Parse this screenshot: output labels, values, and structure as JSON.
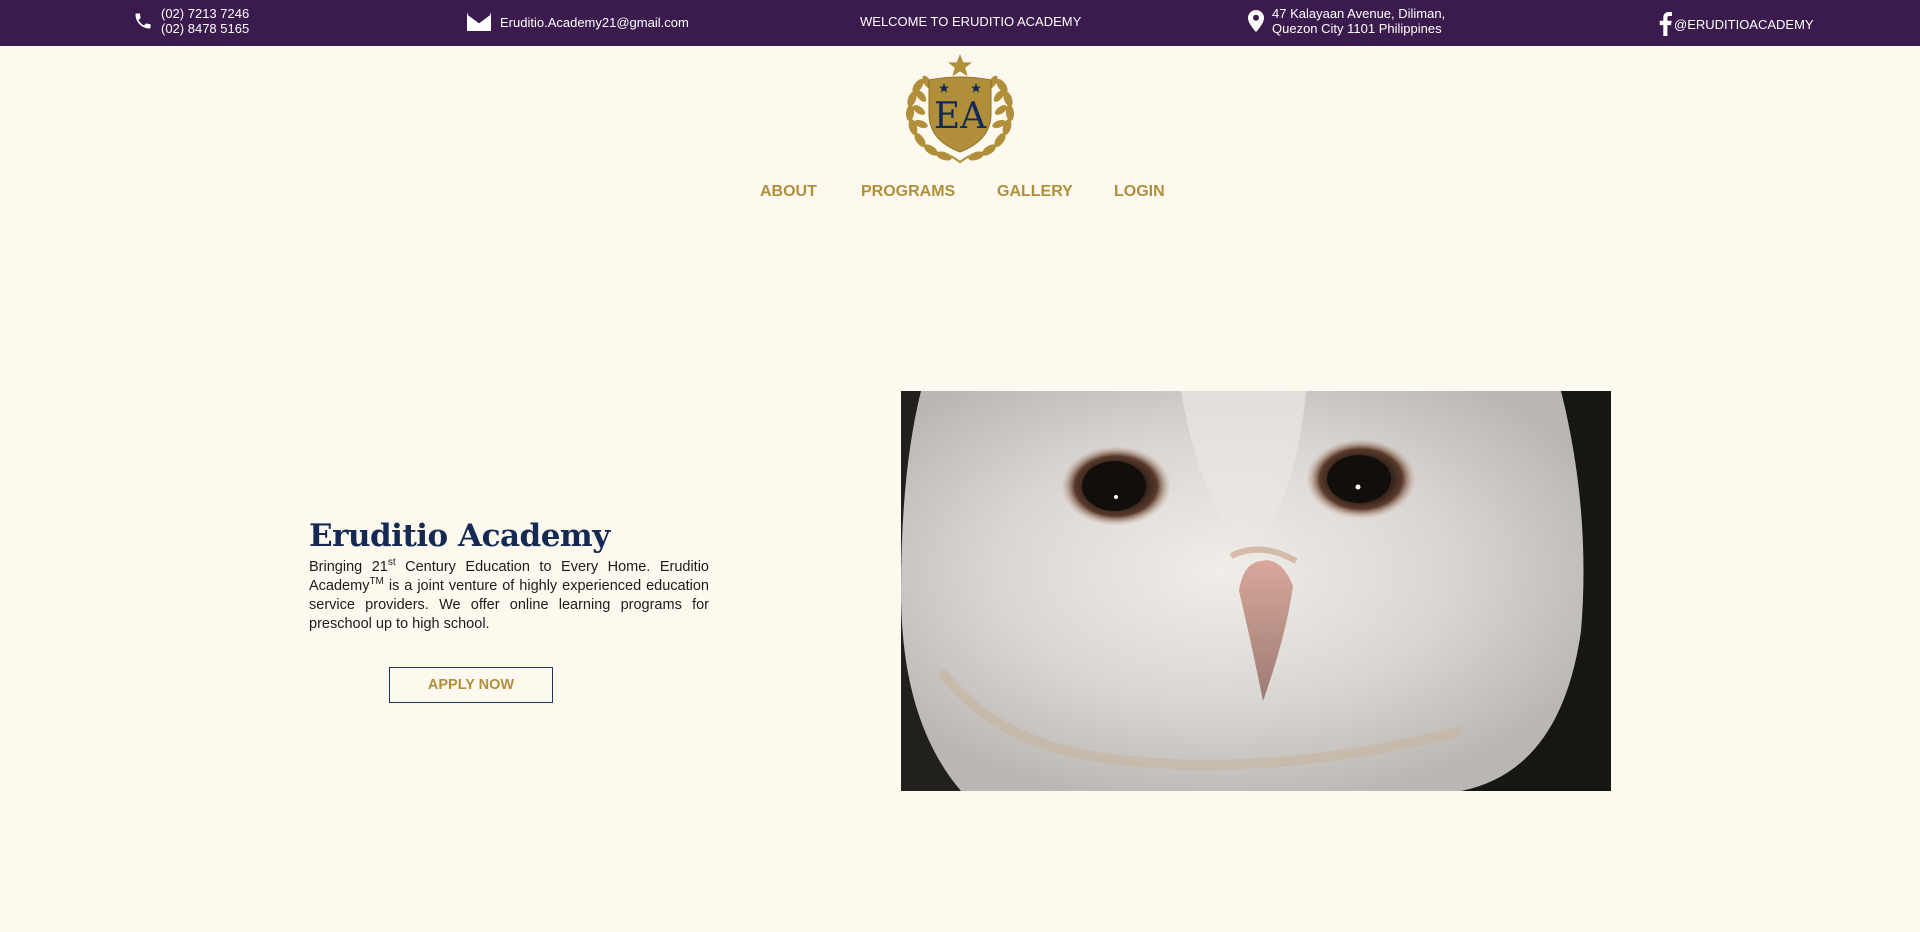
{
  "topbar": {
    "phone_icon": "phone-icon",
    "phone_1": "(02) 7213 7246",
    "phone_2": "(02) 8478 5165",
    "email_icon": "envelope-icon",
    "email": "Eruditio.Academy21@gmail.com",
    "welcome": "WELCOME TO ERUDITIO ACADEMY",
    "address_icon": "map-pin-icon",
    "address_line_1": "47 Kalayaan Avenue, Diliman,",
    "address_line_2": "Quezon City 1101 Philippines",
    "facebook_icon": "facebook-icon",
    "facebook_handle": "@ERUDITIOACADEMY"
  },
  "logo": {
    "monogram": "EA",
    "icon": "academy-crest-logo"
  },
  "nav": {
    "about": "ABOUT",
    "programs": "PROGRAMS",
    "gallery": "GALLERY",
    "login": "LOGIN"
  },
  "hero": {
    "title": "Eruditio Academy",
    "text_bringing": "Bringing 21",
    "text_st": "st",
    "text_century": " Century Education to Every Home. Eruditio Academy",
    "text_tm": "TM",
    "text_rest": " is a joint venture of highly experienced education service providers. We offer online learning programs for preschool up to high school.",
    "apply_button": "APPLY NOW"
  },
  "colors": {
    "topbar_bg": "#3b1a4d",
    "page_bg": "#fef9ee",
    "gold": "#b18f3a",
    "navy": "#142a54"
  }
}
